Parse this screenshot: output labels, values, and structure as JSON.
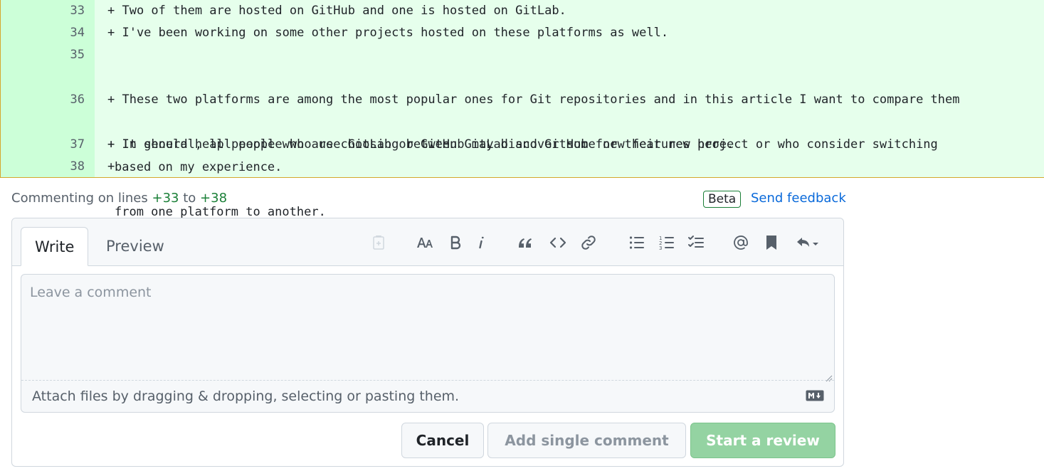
{
  "diff": {
    "rows": [
      {
        "line": "33",
        "text": "+ Two of them are hosted on GitHub and one is hosted on GitLab.",
        "cont": ""
      },
      {
        "line": "34",
        "text": "+ I've been working on some other projects hosted on these platforms as well.",
        "cont": ""
      },
      {
        "line": "35",
        "text": "+ These two platforms are among the most popular ones for Git repositories and in this article I want to compare them",
        "cont": "based on my experience."
      },
      {
        "line": "36",
        "text": "+ It should help people who are choosing between GitLab and GitHub for their new project or who consider switching",
        "cont": "from one platform to another."
      },
      {
        "line": "37",
        "text": "+ In general, all people who use GitLab or GitHub may discover some new features here.",
        "cont": ""
      },
      {
        "line": "38",
        "text": "+",
        "cont": ""
      }
    ]
  },
  "comment_header": {
    "prefix": "Commenting on lines",
    "from": "+33",
    "to_word": "to",
    "to": "+38",
    "beta": "Beta",
    "feedback": "Send feedback"
  },
  "tabs": {
    "write": "Write",
    "preview": "Preview"
  },
  "toolbar_icons": [
    "saved-reply-icon",
    "heading-icon",
    "bold-icon",
    "italic-icon",
    "quote-icon",
    "code-icon",
    "link-icon",
    "unordered-list-icon",
    "ordered-list-icon",
    "task-list-icon",
    "mention-icon",
    "reference-icon",
    "reply-icon"
  ],
  "editor": {
    "placeholder": "Leave a comment",
    "attach_text": "Attach files by dragging & dropping, selecting or pasting them."
  },
  "buttons": {
    "cancel": "Cancel",
    "single": "Add single comment",
    "review": "Start a review"
  },
  "colors": {
    "diff_bg": "#e6ffec",
    "gutter_bg": "#ccffd8",
    "accent_green": "#1a7f37",
    "link_blue": "#0969da",
    "review_btn": "#94d3a2"
  }
}
